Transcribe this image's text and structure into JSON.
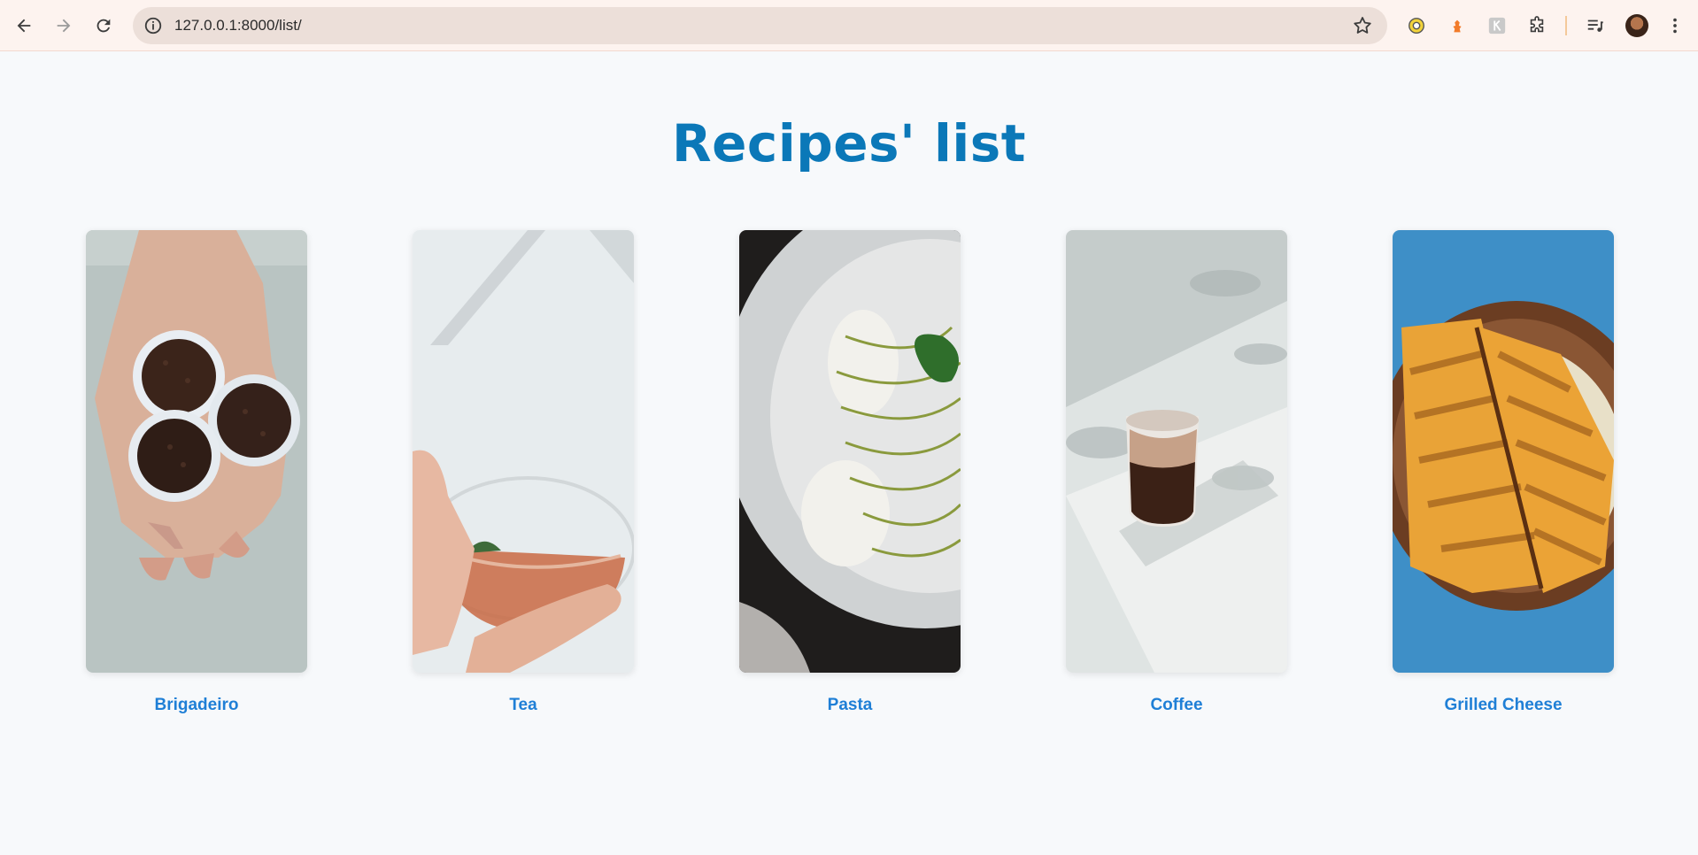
{
  "browser": {
    "url": "127.0.0.1:8000/list/"
  },
  "page": {
    "title": "Recipes' list"
  },
  "recipes": [
    {
      "name": "Brigadeiro"
    },
    {
      "name": "Tea"
    },
    {
      "name": "Pasta"
    },
    {
      "name": "Coffee"
    },
    {
      "name": "Grilled Cheese"
    }
  ],
  "colors": {
    "title": "#0b78b8",
    "link": "#1f7fd6",
    "background": "#f7f9fb"
  }
}
